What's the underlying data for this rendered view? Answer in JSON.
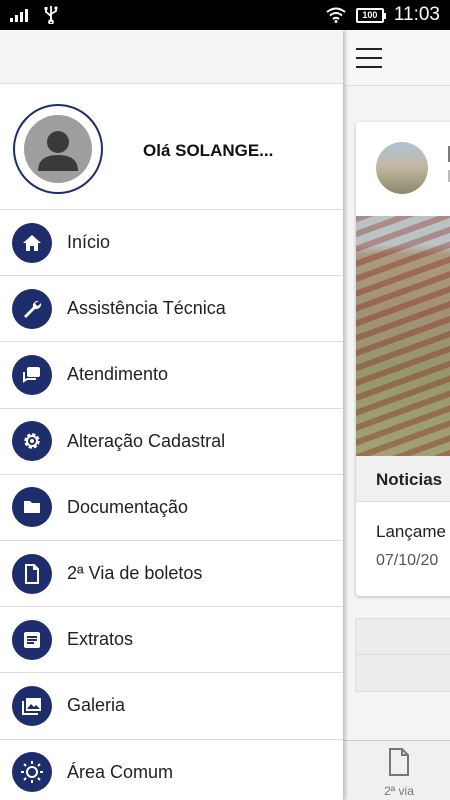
{
  "status_bar": {
    "time": "11:03",
    "battery": "100",
    "icons": [
      "signal-icon",
      "usb-icon",
      "wifi-icon",
      "battery-icon"
    ]
  },
  "drawer": {
    "greeting": "Olá SOLANGE...",
    "menu": [
      {
        "label": "Início",
        "icon": "home-icon"
      },
      {
        "label": "Assistência Técnica",
        "icon": "wrench-icon"
      },
      {
        "label": "Atendimento",
        "icon": "chat-icon"
      },
      {
        "label": "Alteração Cadastral",
        "icon": "gear-icon"
      },
      {
        "label": "Documentação",
        "icon": "folder-icon"
      },
      {
        "label": "2ª Via de boletos",
        "icon": "document-icon"
      },
      {
        "label": "Extratos",
        "icon": "list-icon"
      },
      {
        "label": "Galeria",
        "icon": "gallery-icon"
      },
      {
        "label": "Área Comum",
        "icon": "sun-icon"
      }
    ]
  },
  "background": {
    "section_title": "Noticias",
    "news_title": "Lançame",
    "news_date": "07/10/20",
    "bottom_nav_label": "2ª via"
  },
  "colors": {
    "accent": "#1e2d6b",
    "status_bar": "#000000",
    "divider": "#dddddd"
  }
}
